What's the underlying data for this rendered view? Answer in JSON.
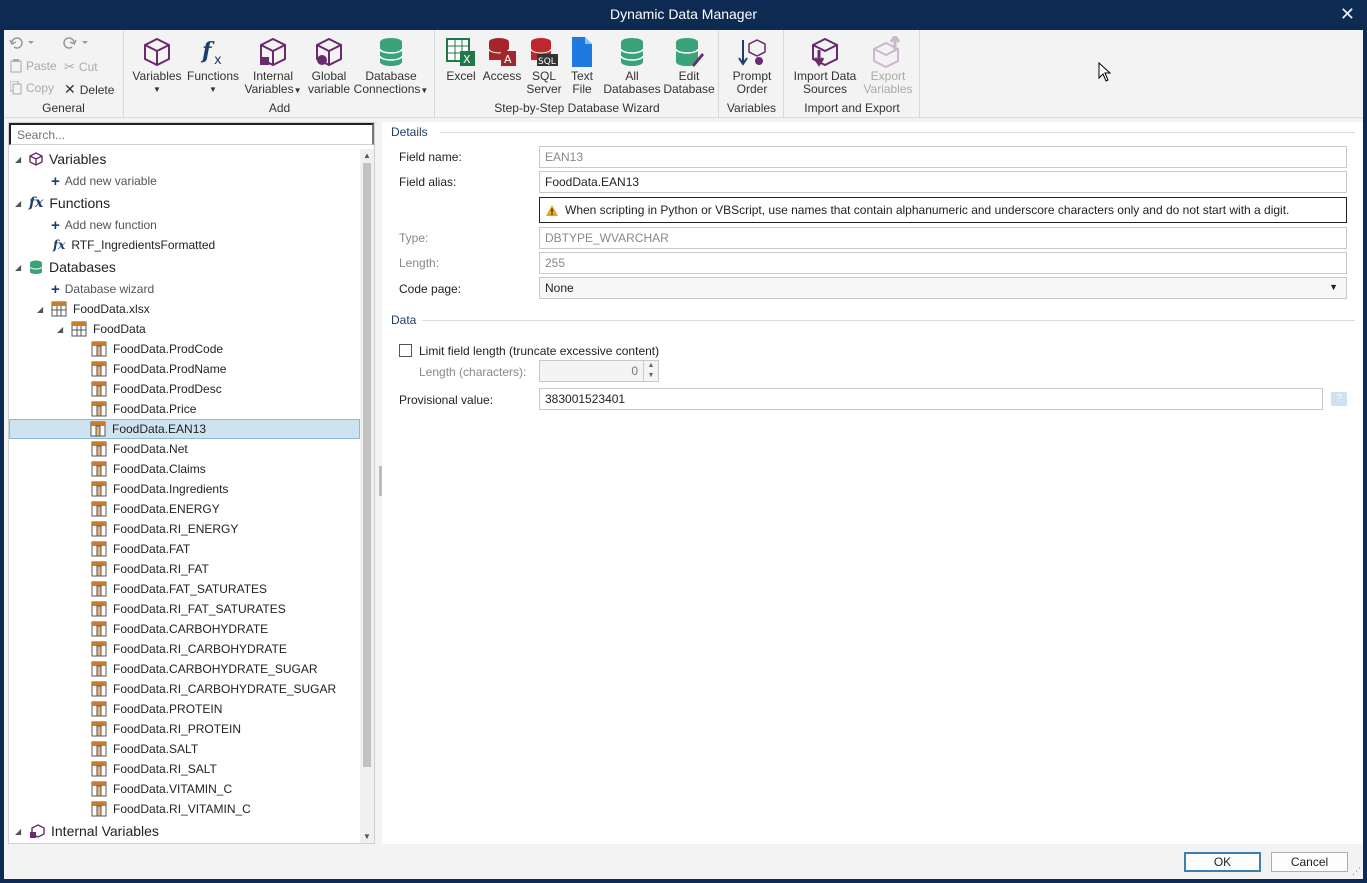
{
  "window": {
    "title": "Dynamic Data Manager",
    "close_glyph": "✕"
  },
  "ribbon": {
    "general": {
      "label": "General",
      "paste": "Paste",
      "cut": "Cut",
      "copy": "Copy",
      "delete": "Delete"
    },
    "add": {
      "label": "Add",
      "variables": "Variables",
      "functions": "Functions",
      "internal_variables_1": "Internal",
      "internal_variables_2": "Variables",
      "global_variable_1": "Global",
      "global_variable_2": "variable",
      "db_connections_1": "Database",
      "db_connections_2": "Connections"
    },
    "wizard": {
      "label": "Step-by-Step Database Wizard",
      "excel": "Excel",
      "access": "Access",
      "sql_1": "SQL",
      "sql_2": "Server",
      "text_1": "Text",
      "text_2": "File",
      "all_1": "All",
      "all_2": "Databases",
      "edit_1": "Edit",
      "edit_2": "Database"
    },
    "variables": {
      "label": "Variables",
      "prompt_1": "Prompt",
      "prompt_2": "Order"
    },
    "import_export": {
      "label": "Import and Export",
      "import_1": "Import Data",
      "import_2": "Sources",
      "export_1": "Export",
      "export_2": "Variables"
    }
  },
  "search": {
    "placeholder": "Search..."
  },
  "tree": {
    "variables": "Variables",
    "add_variable": "Add new variable",
    "functions": "Functions",
    "add_function": "Add new function",
    "function_item": "RTF_IngredientsFormatted",
    "databases": "Databases",
    "db_wizard": "Database wizard",
    "file": "FoodData.xlsx",
    "table": "FoodData",
    "fields": [
      "FoodData.ProdCode",
      "FoodData.ProdName",
      "FoodData.ProdDesc",
      "FoodData.Price",
      "FoodData.EAN13",
      "FoodData.Net",
      "FoodData.Claims",
      "FoodData.Ingredients",
      "FoodData.ENERGY",
      "FoodData.RI_ENERGY",
      "FoodData.FAT",
      "FoodData.RI_FAT",
      "FoodData.FAT_SATURATES",
      "FoodData.RI_FAT_SATURATES",
      "FoodData.CARBOHYDRATE",
      "FoodData.RI_CARBOHYDRATE",
      "FoodData.CARBOHYDRATE_SUGAR",
      "FoodData.RI_CARBOHYDRATE_SUGAR",
      "FoodData.PROTEIN",
      "FoodData.RI_PROTEIN",
      "FoodData.SALT",
      "FoodData.RI_SALT",
      "FoodData.VITAMIN_C",
      "FoodData.RI_VITAMIN_C"
    ],
    "selected": "FoodData.EAN13",
    "internal_variables": "Internal Variables"
  },
  "details": {
    "section": "Details",
    "field_name_label": "Field name:",
    "field_name": "EAN13",
    "field_alias_label": "Field alias:",
    "field_alias": "FoodData.EAN13",
    "warning": "When scripting in Python or VBScript, use names that contain alphanumeric and underscore characters only and do not start with a digit.",
    "type_label": "Type:",
    "type": "DBTYPE_WVARCHAR",
    "length_label": "Length:",
    "length": "255",
    "code_page_label": "Code page:",
    "code_page": "None"
  },
  "data": {
    "section": "Data",
    "limit_label": "Limit field length (truncate excessive content)",
    "limit_checked": false,
    "length_chars_label": "Length (characters):",
    "length_chars": "0",
    "provisional_label": "Provisional value:",
    "provisional_value": "383001523401"
  },
  "footer": {
    "ok": "OK",
    "cancel": "Cancel"
  }
}
